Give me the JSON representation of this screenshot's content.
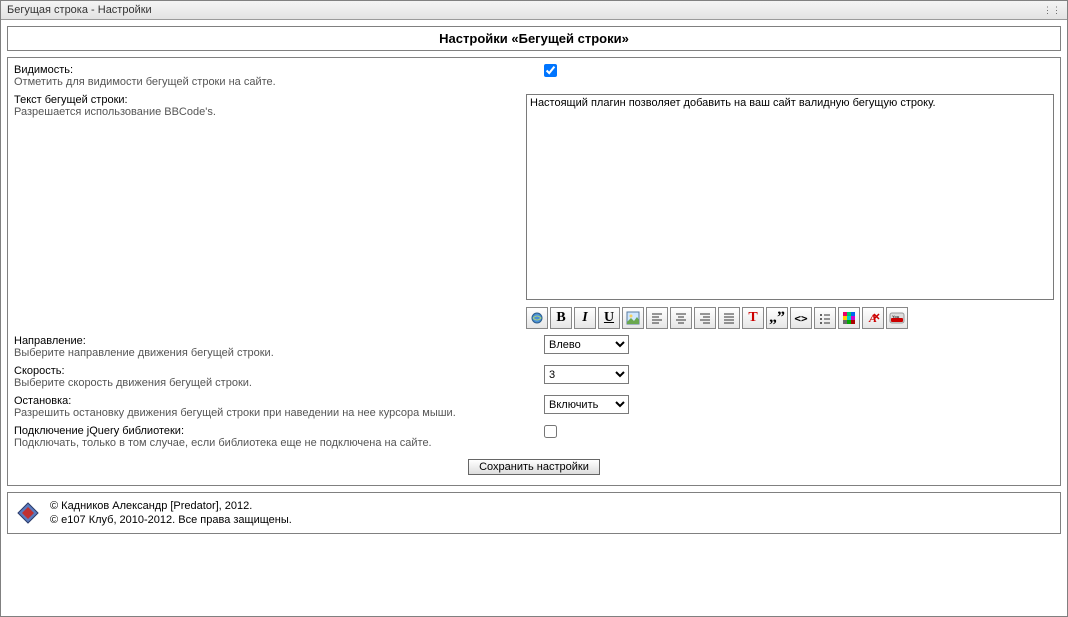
{
  "window": {
    "title": "Бегущая строка - Настройки"
  },
  "panel": {
    "title": "Настройки «Бегущей строки»"
  },
  "fields": {
    "visibility": {
      "label": "Видимость:",
      "hint": "Отметить для видимости бегущей строки на сайте.",
      "checked": true
    },
    "text": {
      "label": "Текст бегущей строки:",
      "hint": "Разрешается использование BBCode's.",
      "value": "Настоящий плагин позволяет добавить на ваш сайт валидную бегущую строку."
    },
    "direction": {
      "label": "Направление:",
      "hint": "Выберите направление движения бегущей строки.",
      "value": "Влево"
    },
    "speed": {
      "label": "Скорость:",
      "hint": "Выберите скорость движения бегущей строки.",
      "value": "3"
    },
    "stop": {
      "label": "Остановка:",
      "hint": "Разрешить остановку движения бегущей строки при наведении на нее курсора мыши.",
      "value": "Включить"
    },
    "jquery": {
      "label": "Подключение jQuery библиотеки:",
      "hint": "Подключать, только в том случае, если библиотека еще не подключена на сайте.",
      "checked": false
    }
  },
  "toolbar": {
    "bold": "B",
    "italic": "I",
    "underline": "U",
    "textsize": "T",
    "quote": "„”",
    "code": "<>"
  },
  "submit": {
    "label": "Сохранить настройки"
  },
  "footer": {
    "line1": "© Кадников Александр [Predator], 2012.",
    "line2": "© e107 Клуб, 2010-2012. Все права защищены."
  }
}
